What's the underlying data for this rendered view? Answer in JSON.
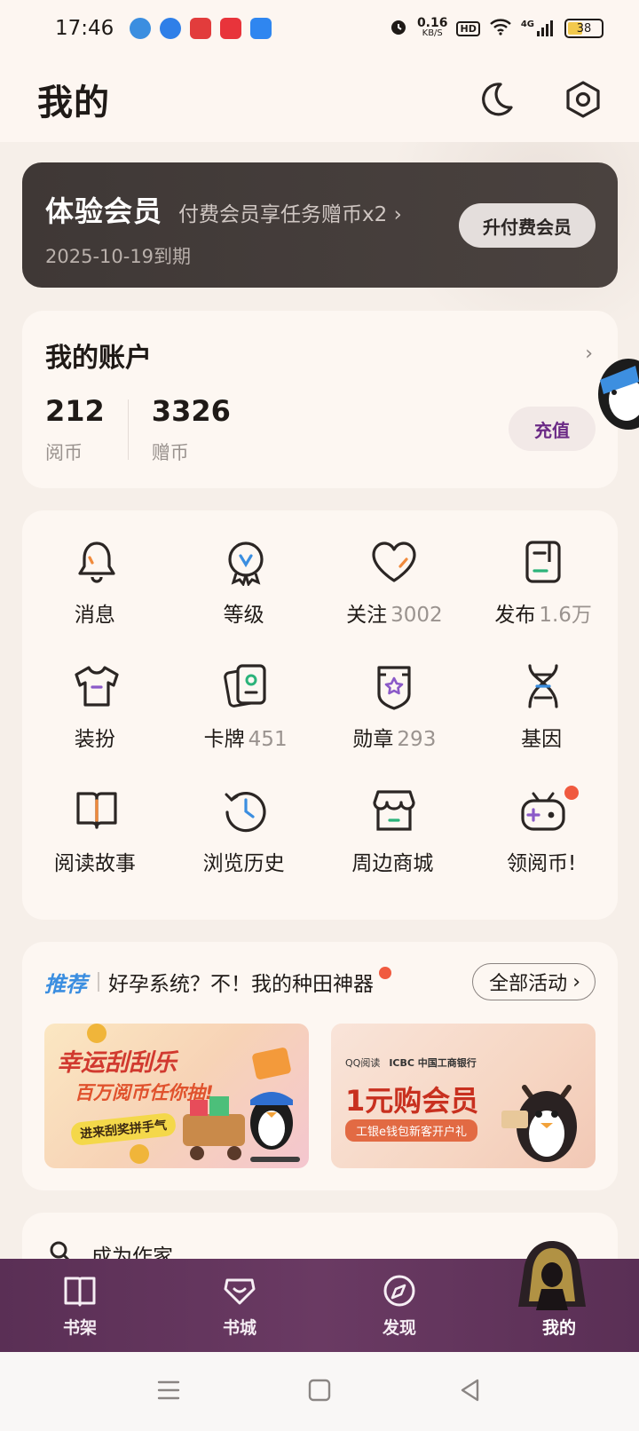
{
  "status_bar": {
    "time": "17:46",
    "speed_value": "0.16",
    "speed_unit": "KB/S",
    "hd": "HD",
    "network": "4G",
    "battery": "38",
    "app_icon_colors": [
      "#3b8ee0",
      "#2f7fe8",
      "#e23c3c",
      "#e8343b",
      "#2f86f0"
    ]
  },
  "header": {
    "title": "我的",
    "icons": [
      "moon-icon",
      "settings-icon"
    ]
  },
  "member": {
    "title": "体验会员",
    "promo": "付费会员享任务赠币x2 ›",
    "expire": "2025-10-19到期",
    "upgrade_label": "升付费会员"
  },
  "account": {
    "title": "我的账户",
    "balances": [
      {
        "value": "212",
        "label": "阅币"
      },
      {
        "value": "3326",
        "label": "赠币"
      }
    ],
    "recharge_label": "充值"
  },
  "grid": [
    {
      "label": "消息",
      "count": "",
      "icon": "bell-icon"
    },
    {
      "label": "等级",
      "count": "",
      "icon": "level-badge-icon"
    },
    {
      "label": "关注",
      "count": "3002",
      "icon": "heart-icon"
    },
    {
      "label": "发布",
      "count": "1.6万",
      "icon": "publish-icon"
    },
    {
      "label": "装扮",
      "count": "",
      "icon": "tshirt-icon"
    },
    {
      "label": "卡牌",
      "count": "451",
      "icon": "cards-icon"
    },
    {
      "label": "勋章",
      "count": "293",
      "icon": "medal-icon"
    },
    {
      "label": "基因",
      "count": "",
      "icon": "dna-icon"
    },
    {
      "label": "阅读故事",
      "count": "",
      "icon": "book-icon"
    },
    {
      "label": "浏览历史",
      "count": "",
      "icon": "history-icon"
    },
    {
      "label": "周边商城",
      "count": "",
      "icon": "store-icon"
    },
    {
      "label": "领阅币!",
      "count": "",
      "icon": "gamepad-icon"
    }
  ],
  "activity": {
    "tag": "推荐",
    "title": "好孕系统？不！我的种田神器",
    "all_label": "全部活动",
    "banner_a": {
      "title": "幸运刮刮乐",
      "subtitle": "百万阅币任你抽!",
      "pill": "进来刮奖拼手气"
    },
    "banner_b": {
      "brand_left": "QQ阅读",
      "brand_right": "ICBC 中国工商银行",
      "title": "1元购会员",
      "subtitle": "工银e钱包新客开户礼"
    }
  },
  "next_card": {
    "label": "成为作家"
  },
  "tabbar": {
    "tabs": [
      {
        "label": "书架"
      },
      {
        "label": "书城"
      },
      {
        "label": "发现"
      },
      {
        "label": "我的"
      }
    ]
  }
}
